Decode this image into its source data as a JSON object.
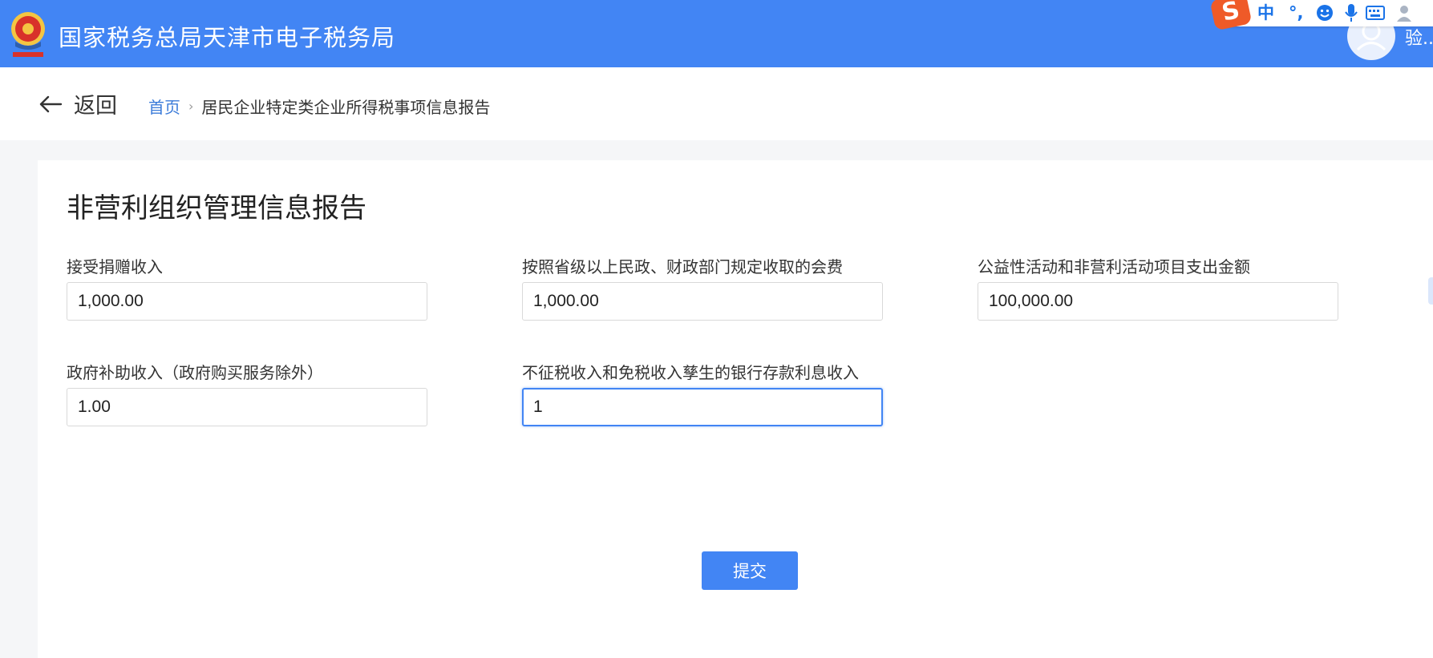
{
  "header": {
    "site_title": "国家税务总局天津市电子税务局",
    "username": "验...",
    "brand_color": "#4285f4"
  },
  "ime_toolbar": {
    "logo_text": "S",
    "lang": "中",
    "punct": "°,",
    "icons": [
      "emoji-icon",
      "microphone-icon",
      "keyboard-icon",
      "user-icon"
    ]
  },
  "nav": {
    "back_label": "返回",
    "breadcrumb_home": "首页",
    "breadcrumb_separator": "›",
    "breadcrumb_current": "居民企业特定类企业所得税事项信息报告"
  },
  "form": {
    "title": "非营利组织管理信息报告",
    "fields": [
      {
        "label": "接受捐赠收入",
        "value": "1,000.00"
      },
      {
        "label": "按照省级以上民政、财政部门规定收取的会费",
        "value": "1,000.00"
      },
      {
        "label": "公益性活动和非营利活动项目支出金额",
        "value": "100,000.00"
      },
      {
        "label": "政府补助收入（政府购买服务除外）",
        "value": "1.00"
      },
      {
        "label": "不征税收入和免税收入孳生的银行存款利息收入",
        "value": "1"
      }
    ],
    "submit_label": "提交"
  }
}
